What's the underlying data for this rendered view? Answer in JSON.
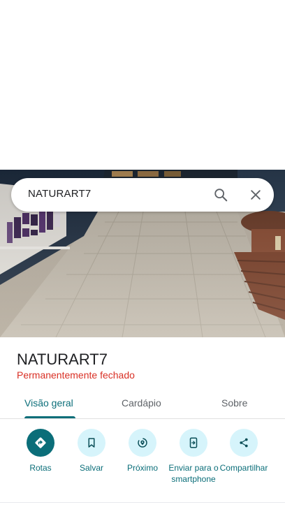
{
  "search": {
    "query": "NATURART7"
  },
  "place": {
    "name": "NATURART7",
    "status": "Permanentemente fechado"
  },
  "tabs": [
    {
      "label": "Visão geral",
      "active": true
    },
    {
      "label": "Cardápio",
      "active": false
    },
    {
      "label": "Sobre",
      "active": false
    }
  ],
  "actions": [
    {
      "label": "Rotas",
      "icon": "directions-icon"
    },
    {
      "label": "Salvar",
      "icon": "bookmark-icon"
    },
    {
      "label": "Próximo",
      "icon": "nearby-icon"
    },
    {
      "label": "Enviar para o smartphone",
      "icon": "send-to-phone-icon"
    },
    {
      "label": "Compartilhar",
      "icon": "share-icon"
    }
  ],
  "colors": {
    "accent": "#0b6e79",
    "action_bg": "#d6f4fb",
    "status_closed": "#d93025"
  }
}
